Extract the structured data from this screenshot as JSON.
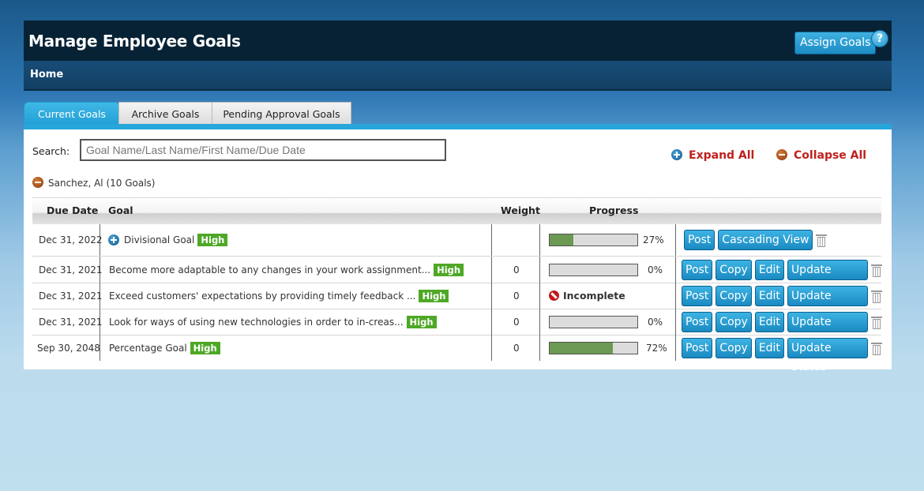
{
  "header": {
    "title": "Manage Employee Goals",
    "assign_label": "Assign Goals",
    "help_glyph": "?"
  },
  "nav": {
    "home": "Home"
  },
  "tabs": [
    {
      "label": "Current Goals",
      "active": true
    },
    {
      "label": "Archive Goals",
      "active": false
    },
    {
      "label": "Pending Approval Goals",
      "active": false
    }
  ],
  "search": {
    "label": "Search:",
    "placeholder": "Goal Name/Last Name/First Name/Due Date",
    "value": ""
  },
  "controls": {
    "expand_all": "Expand All",
    "collapse_all": "Collapse All"
  },
  "group": {
    "label": "Sanchez, Al (10 Goals)"
  },
  "table": {
    "headers": {
      "due_date": "Due Date",
      "goal": "Goal",
      "weight": "Weight",
      "progress": "Progress"
    },
    "rows": [
      {
        "due": "Dec 31, 2022",
        "goal": "Divisional Goal",
        "priority": "High",
        "weight": "",
        "progress_pct": 27,
        "progress_text": "27%",
        "actions": [
          "Post",
          "Cascading View"
        ]
      },
      {
        "due": "Dec 31, 2021",
        "goal": "Become more adaptable to any changes in your work assignment...",
        "priority": "High",
        "weight": "0",
        "progress_pct": 0,
        "progress_text": "0%",
        "actions": [
          "Post",
          "Copy",
          "Edit",
          "Update Status"
        ]
      },
      {
        "due": "Dec 31, 2021",
        "goal": "Exceed customers' expectations by providing timely feedback ...",
        "priority": "High",
        "weight": "0",
        "status": "Incomplete",
        "actions": [
          "Post",
          "Copy",
          "Edit",
          "Update Status"
        ]
      },
      {
        "due": "Dec 31, 2021",
        "goal": "Look for ways of using new technologies in order to in-creas...",
        "priority": "High",
        "weight": "0",
        "progress_pct": 0,
        "progress_text": "0%",
        "actions": [
          "Post",
          "Copy",
          "Edit",
          "Update Status"
        ]
      },
      {
        "due": "Sep 30, 2048",
        "goal": "Percentage Goal",
        "priority": "High",
        "weight": "0",
        "progress_pct": 72,
        "progress_text": "72%",
        "actions": [
          "Post",
          "Copy",
          "Edit",
          "Update Status"
        ]
      }
    ]
  },
  "colors": {
    "accent": "#27a6dc",
    "priority_high": "#4ea826",
    "progress_fill": "#6b9a52",
    "link_red": "#c0201e"
  }
}
